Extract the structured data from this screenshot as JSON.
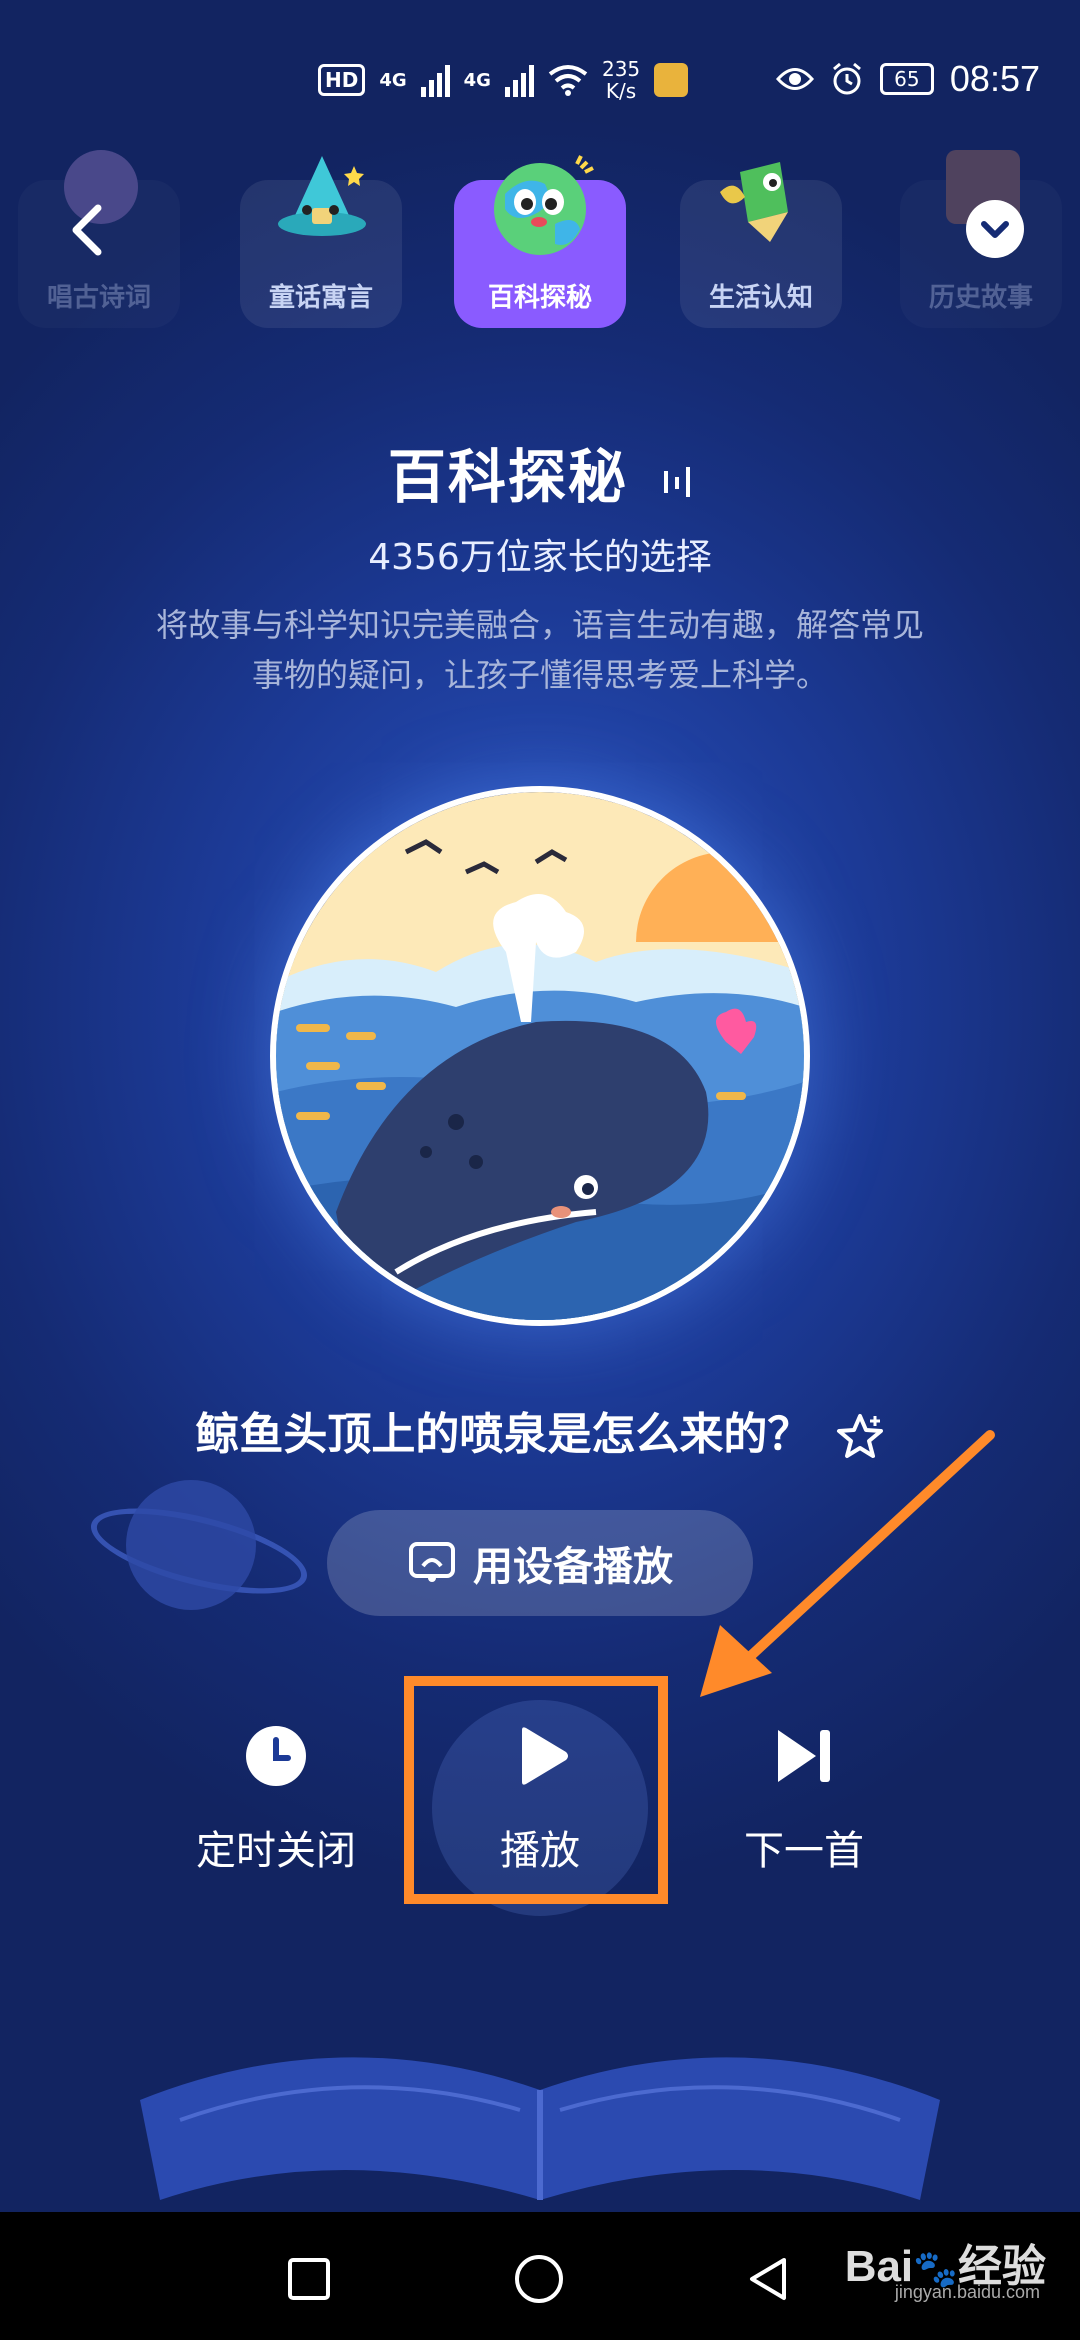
{
  "status_bar": {
    "hd": "HD",
    "net1": "4G",
    "net2": "4G",
    "speed_value": "235",
    "speed_unit": "K/s",
    "battery": "65",
    "time": "08:57"
  },
  "tabs": [
    {
      "label": "唱古诗词",
      "active": false
    },
    {
      "label": "童话寓言",
      "active": false
    },
    {
      "label": "百科探秘",
      "active": true
    },
    {
      "label": "生活认知",
      "active": false
    },
    {
      "label": "历史故事",
      "active": false
    }
  ],
  "header": {
    "title": "百科探秘",
    "subtitle": "4356万位家长的选择",
    "description": "将故事与科学知识完美融合，语言生动有趣，解答常见事物的疑问，让孩子懂得思考爱上科学。"
  },
  "player": {
    "track_title": "鲸鱼头顶上的喷泉是怎么来的？",
    "device_button": "用设备播放",
    "timer_label": "定时关闭",
    "play_label": "播放",
    "next_label": "下一首"
  },
  "watermark": {
    "brand": "Bai",
    "brand2": "经验",
    "url": "jingyan.baidu.com"
  },
  "colors": {
    "background": "#1c3a96",
    "active_tab": "#8a5bff",
    "highlight": "#ff8a2a"
  },
  "icons": [
    "back-icon",
    "chevron-down-icon",
    "star-icon",
    "cast-icon",
    "clock-icon",
    "play-icon",
    "skip-next-icon",
    "home-icon",
    "recent-apps-icon",
    "nav-back-icon"
  ]
}
